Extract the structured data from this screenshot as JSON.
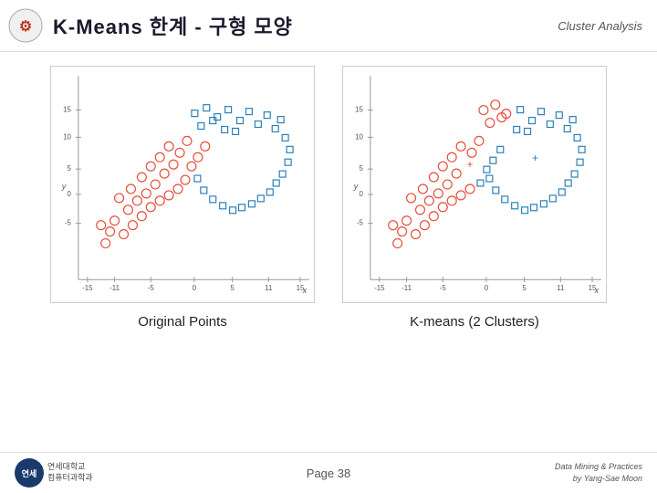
{
  "header": {
    "title": "K-Means 한계 - 구형 모양",
    "subtitle": "Cluster Analysis"
  },
  "charts": [
    {
      "id": "chart-original",
      "label": "Original Points"
    },
    {
      "id": "chart-kmeans",
      "label": "K-means (2 Clusters)"
    }
  ],
  "footer": {
    "page_label": "Page 38",
    "credit_line1": "Data Mining & Practices",
    "credit_line2": "by Yang-Sae Moon"
  },
  "axis": {
    "x": "x",
    "y": "y"
  }
}
